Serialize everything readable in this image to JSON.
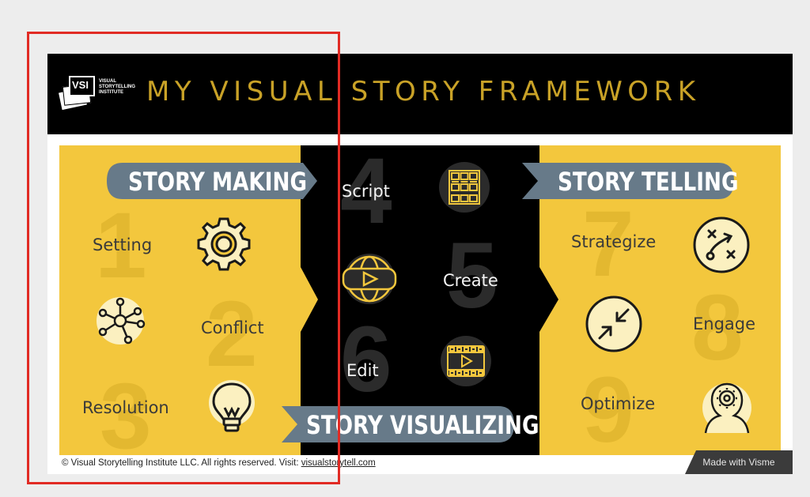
{
  "header": {
    "logo_mark": "VSI",
    "logo_caption": [
      "VISUAL",
      "STORYTELLING",
      "INSTITUTE"
    ],
    "title": "MY VISUAL STORY FRAMEWORK"
  },
  "story_making": {
    "banner": "STORY MAKING",
    "steps": [
      {
        "number": "1",
        "label": "Setting",
        "icon": "gear-icon"
      },
      {
        "number": "2",
        "label": "Conflict",
        "icon": "network-nodes-icon"
      },
      {
        "number": "3",
        "label": "Resolution",
        "icon": "lightbulb-icon"
      }
    ]
  },
  "story_visualizing": {
    "banner": "STORY VISUALIZING",
    "steps": [
      {
        "number": "4",
        "label": "Script",
        "icon": "storyboard-grid-icon"
      },
      {
        "number": "5",
        "label": "Create",
        "icon": "globe-play-icon"
      },
      {
        "number": "6",
        "label": "Edit",
        "icon": "film-strip-play-icon"
      }
    ]
  },
  "story_telling": {
    "banner": "STORY TELLING",
    "steps": [
      {
        "number": "7",
        "label": "Strategize",
        "icon": "play-diagram-icon"
      },
      {
        "number": "8",
        "label": "Engage",
        "icon": "converging-arrows-icon"
      },
      {
        "number": "9",
        "label": "Optimize",
        "icon": "head-gear-icon"
      }
    ]
  },
  "footer": {
    "copyright": "© Visual Storytelling Institute LLC. All rights reserved. Visit: ",
    "link": "visualstorytell.com",
    "badge": "Made with Visme"
  },
  "colors": {
    "yellow": "#f3c73d",
    "black": "#000000",
    "banner_slate": "#677a89",
    "gold_title": "#c9a227",
    "icon_cream": "#fbf0c0",
    "highlight_box": "#e12b24"
  }
}
